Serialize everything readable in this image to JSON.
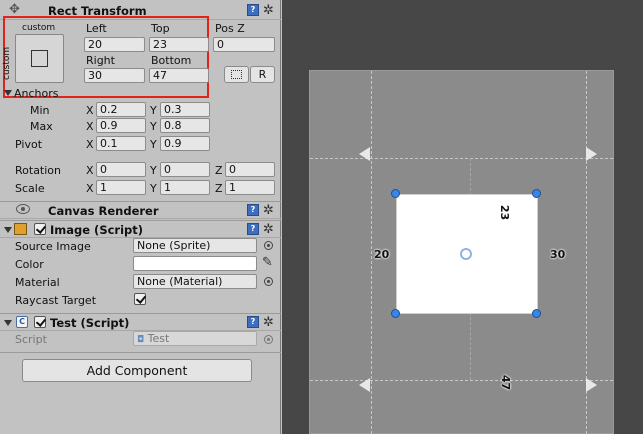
{
  "rect_transform": {
    "title": "Rect Transform",
    "anchor_preset": "custom",
    "anchor_preset_side": "custom",
    "left_label": "Left",
    "left_value": "20",
    "top_label": "Top",
    "top_value": "23",
    "posz_label": "Pos Z",
    "posz_value": "0",
    "right_label": "Right",
    "right_value": "30",
    "bottom_label": "Bottom",
    "bottom_value": "47",
    "raw_button": "R",
    "anchors_label": "Anchors",
    "min_label": "Min",
    "min_x": "0.2",
    "min_y": "0.3",
    "max_label": "Max",
    "max_x": "0.9",
    "max_y": "0.8",
    "pivot_label": "Pivot",
    "pivot_x": "0.1",
    "pivot_y": "0.9",
    "rotation_label": "Rotation",
    "rot_x": "0",
    "rot_y": "0",
    "rot_z": "0",
    "scale_label": "Scale",
    "scale_x": "1",
    "scale_y": "1",
    "scale_z": "1",
    "axis_x": "X",
    "axis_y": "Y",
    "axis_z": "Z"
  },
  "canvas_renderer": {
    "title": "Canvas Renderer"
  },
  "image": {
    "title": "Image (Script)",
    "source_label": "Source Image",
    "source_value": "None (Sprite)",
    "color_label": "Color",
    "material_label": "Material",
    "material_value": "None (Material)",
    "raycast_label": "Raycast Target"
  },
  "test": {
    "title": "Test (Script)",
    "script_label": "Script",
    "script_value": "Test"
  },
  "add_component": "Add Component",
  "help_glyph": "?",
  "gear_glyph": "✲",
  "scene": {
    "left_offset": "20",
    "right_offset": "30",
    "top_offset": "23",
    "bottom_offset": "47"
  },
  "colors": {
    "highlight": "#e0241b",
    "handle": "#3a86e8",
    "image_color": "#ffffff"
  }
}
